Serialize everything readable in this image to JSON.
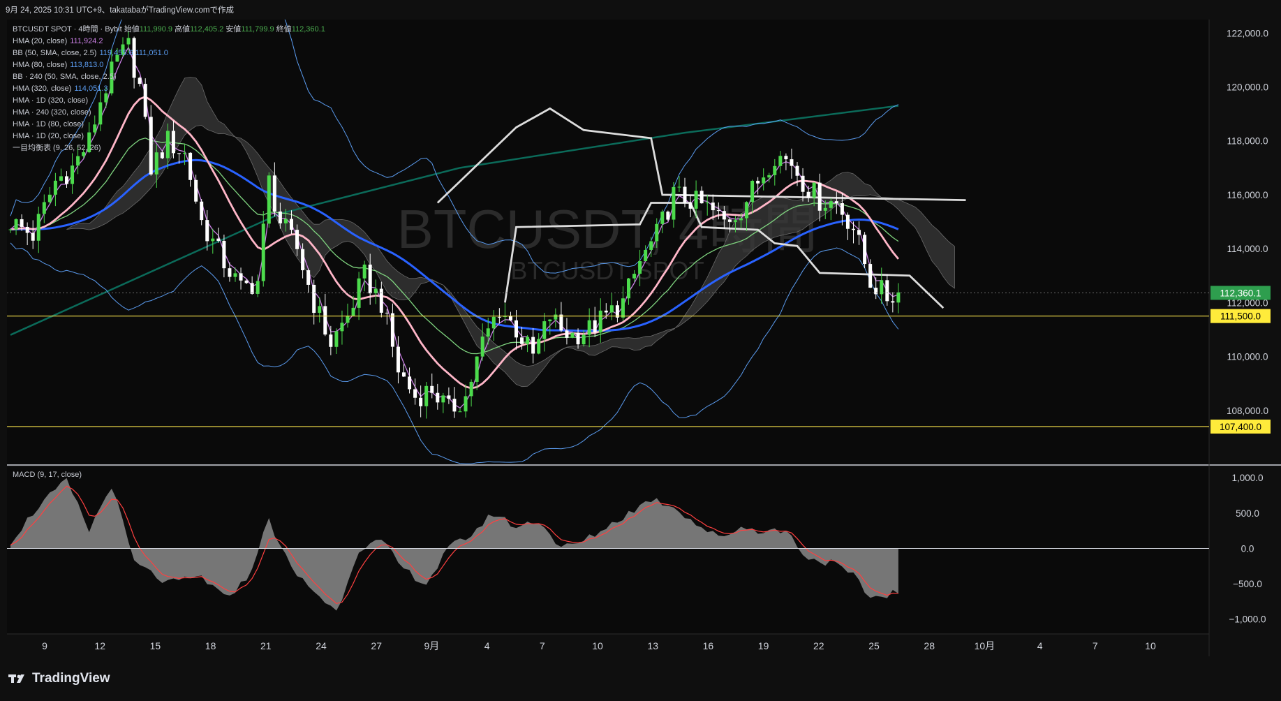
{
  "header": {
    "text": "9月 24, 2025 10:31 UTC+9、takatabaがTradingView.comで作成"
  },
  "legend": {
    "symbol": "BTCUSDT SPOT · 4時間 · Bybit",
    "open_label": "始値",
    "open": "111,990.9",
    "high_label": "高値",
    "high": "112,405.2",
    "low_label": "安値",
    "low": "111,799.9",
    "close_label": "終値",
    "close": "112,360.1",
    "indicators": [
      {
        "name": "HMA (20, close)",
        "value": "111,924.2",
        "color": "#c97fe3"
      },
      {
        "name": "BB (50, SMA, close, 2.5)",
        "value": "119,455.6  111,051.0",
        "color": "#5b9cf0"
      },
      {
        "name": "HMA (80, close)",
        "value": "113,813.0",
        "color": "#5b9cf0"
      },
      {
        "name": "BB · 240 (50, SMA, close, 2.5)",
        "value": "",
        "color": "#d1d4dc"
      },
      {
        "name": "HMA (320, close)",
        "value": "114,051.3",
        "color": "#5b9cf0"
      },
      {
        "name": "HMA · 1D (320, close)",
        "value": "",
        "color": "#d1d4dc"
      },
      {
        "name": "HMA · 240 (320, close)",
        "value": "",
        "color": "#d1d4dc"
      },
      {
        "name": "HMA · 1D (80, close)",
        "value": "",
        "color": "#d1d4dc"
      },
      {
        "name": "HMA · 1D (20, close)",
        "value": "",
        "color": "#d1d4dc"
      },
      {
        "name": "一目均衡表 (9, 26, 52, 26)",
        "value": "",
        "color": "#d1d4dc"
      }
    ]
  },
  "watermark": {
    "main": "BTCUSDT, 4時間",
    "sub": "BTCUSDT SPOT"
  },
  "macd_legend": "MACD (9, 17, close)",
  "footer": {
    "brand": "TradingView"
  },
  "colors": {
    "background": "#0f0f0f",
    "up": "#4cdb4c",
    "down": "#ffffff",
    "hma20": "#c97fe3",
    "hma80": "#ffb6c8",
    "hma320": "#2962ff",
    "bb": "#5b9cf0",
    "green_ma": "#7fd47f",
    "teal": "#0b6b5a",
    "level_line": "#f5e04b",
    "cloud": "#3a3a3a",
    "macd_hist": "#8a8a8a",
    "macd_signal": "#ff4040"
  },
  "chart_data": [
    {
      "type": "candlestick",
      "symbol": "BTCUSDT SPOT",
      "timeframe": "4時間",
      "ylim": [
        106000,
        122500
      ],
      "yticks": [
        108000,
        110000,
        112000,
        114000,
        116000,
        118000,
        120000,
        122000
      ],
      "ytick_labels": [
        "108,000.0",
        "110,000.0",
        "112,000.0",
        "114,000.0",
        "116,000.0",
        "118,000.0",
        "120,000.0",
        "122,000.0"
      ],
      "xtick_labels": [
        "9",
        "12",
        "15",
        "18",
        "21",
        "24",
        "27",
        "9月",
        "4",
        "7",
        "10",
        "13",
        "16",
        "19",
        "22",
        "25",
        "28",
        "10月",
        "4",
        "7",
        "10"
      ],
      "current_price": {
        "value": 112360.1,
        "label": "112,360.1",
        "color": "#2e9e4e"
      },
      "horizontal_levels": [
        {
          "value": 111500,
          "label": "111,500.0",
          "color": "#f5e04b"
        },
        {
          "value": 107400,
          "label": "107,400.0",
          "color": "#f5e04b"
        }
      ],
      "price_path": [
        [
          0,
          115000
        ],
        [
          4,
          114500
        ],
        [
          8,
          116500
        ],
        [
          11,
          117000
        ],
        [
          14,
          118000
        ],
        [
          16,
          119500
        ],
        [
          19,
          121000
        ],
        [
          21,
          121500
        ],
        [
          23,
          120000
        ],
        [
          25,
          117000
        ],
        [
          28,
          118000
        ],
        [
          31,
          117500
        ],
        [
          34,
          115000
        ],
        [
          38,
          113500
        ],
        [
          41,
          112500
        ],
        [
          44,
          112800
        ],
        [
          46,
          116500
        ],
        [
          48,
          115000
        ],
        [
          51,
          114000
        ],
        [
          54,
          112000
        ],
        [
          57,
          110500
        ],
        [
          60,
          111500
        ],
        [
          63,
          113000
        ],
        [
          66,
          112000
        ],
        [
          69,
          109500
        ],
        [
          72,
          108500
        ],
        [
          75,
          108800
        ],
        [
          78,
          108000
        ],
        [
          81,
          108500
        ],
        [
          84,
          110500
        ],
        [
          87,
          111800
        ],
        [
          90,
          111000
        ],
        [
          93,
          110000
        ],
        [
          96,
          111500
        ],
        [
          98,
          111000
        ],
        [
          100,
          110800
        ],
        [
          103,
          111000
        ],
        [
          106,
          111500
        ],
        [
          109,
          112000
        ],
        [
          112,
          113500
        ],
        [
          115,
          114500
        ],
        [
          118,
          116000
        ],
        [
          121,
          115800
        ],
        [
          124,
          115500
        ],
        [
          127,
          115000
        ],
        [
          130,
          115500
        ],
        [
          133,
          116500
        ],
        [
          136,
          117500
        ],
        [
          139,
          117200
        ],
        [
          141,
          116500
        ],
        [
          144,
          115800
        ],
        [
          147,
          115700
        ],
        [
          150,
          114800
        ],
        [
          153,
          112800
        ],
        [
          156,
          112200
        ],
        [
          158,
          112360
        ]
      ],
      "candle_count": 159
    },
    {
      "type": "area",
      "name": "MACD (9, 17, close)",
      "ylim": [
        -1200,
        1150
      ],
      "yticks": [
        -1000,
        -500,
        0,
        500,
        1000
      ],
      "ytick_labels": [
        "−1,000.0",
        "−500.0",
        "0.0",
        "500.0",
        "1,000.0"
      ],
      "hist_path": [
        [
          0,
          100
        ],
        [
          5,
          600
        ],
        [
          10,
          950
        ],
        [
          14,
          250
        ],
        [
          18,
          900
        ],
        [
          22,
          -200
        ],
        [
          28,
          -500
        ],
        [
          34,
          -400
        ],
        [
          38,
          -700
        ],
        [
          42,
          -450
        ],
        [
          46,
          400
        ],
        [
          50,
          -300
        ],
        [
          54,
          -600
        ],
        [
          58,
          -900
        ],
        [
          62,
          0
        ],
        [
          66,
          100
        ],
        [
          70,
          -300
        ],
        [
          74,
          -500
        ],
        [
          78,
          0
        ],
        [
          82,
          200
        ],
        [
          86,
          500
        ],
        [
          90,
          300
        ],
        [
          94,
          400
        ],
        [
          98,
          0
        ],
        [
          102,
          100
        ],
        [
          106,
          300
        ],
        [
          110,
          500
        ],
        [
          114,
          700
        ],
        [
          118,
          600
        ],
        [
          122,
          350
        ],
        [
          126,
          150
        ],
        [
          130,
          300
        ],
        [
          134,
          250
        ],
        [
          138,
          250
        ],
        [
          142,
          -150
        ],
        [
          146,
          -200
        ],
        [
          150,
          -400
        ],
        [
          153,
          -700
        ],
        [
          156,
          -650
        ],
        [
          158,
          -600
        ]
      ]
    }
  ]
}
